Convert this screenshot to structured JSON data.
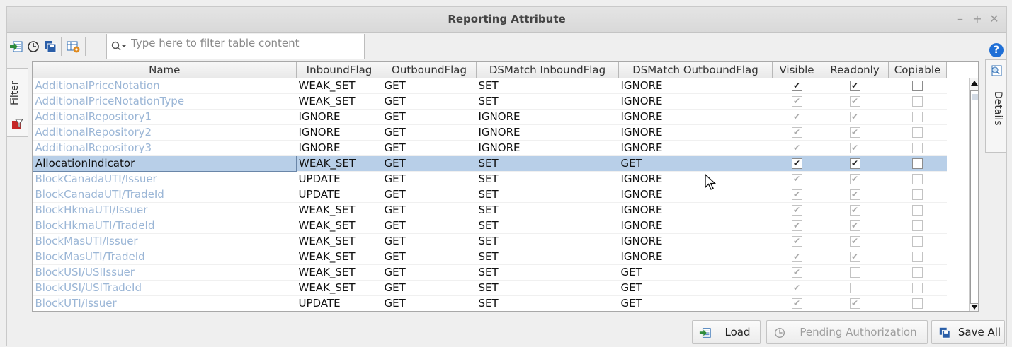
{
  "window": {
    "title": "Reporting Attribute",
    "minimize": "–",
    "maximize": "+",
    "close": "✕"
  },
  "toolbar": {
    "search_placeholder": "Type here to filter table content",
    "help": "?"
  },
  "side_tabs": {
    "filter": "Filter",
    "details": "Details"
  },
  "table": {
    "columns": [
      "Name",
      "InboundFlag",
      "OutboundFlag",
      "DSMatch InboundFlag",
      "DSMatch OutboundFlag",
      "Visible",
      "Readonly",
      "Copiable"
    ],
    "rows": [
      {
        "name": "AdditionalPriceNotation",
        "inbound": "WEAK_SET",
        "outbound": "GET",
        "ds_in": "SET",
        "ds_out": "IGNORE",
        "visible": true,
        "readonly": true,
        "copiable": false,
        "enabled": true
      },
      {
        "name": "AdditionalPriceNotationType",
        "inbound": "WEAK_SET",
        "outbound": "GET",
        "ds_in": "SET",
        "ds_out": "IGNORE",
        "visible": true,
        "readonly": true,
        "copiable": false,
        "enabled": false
      },
      {
        "name": "AdditionalRepository1",
        "inbound": "IGNORE",
        "outbound": "GET",
        "ds_in": "IGNORE",
        "ds_out": "IGNORE",
        "visible": true,
        "readonly": true,
        "copiable": false,
        "enabled": false
      },
      {
        "name": "AdditionalRepository2",
        "inbound": "IGNORE",
        "outbound": "GET",
        "ds_in": "IGNORE",
        "ds_out": "IGNORE",
        "visible": true,
        "readonly": true,
        "copiable": false,
        "enabled": false
      },
      {
        "name": "AdditionalRepository3",
        "inbound": "IGNORE",
        "outbound": "GET",
        "ds_in": "IGNORE",
        "ds_out": "IGNORE",
        "visible": true,
        "readonly": true,
        "copiable": false,
        "enabled": false
      },
      {
        "name": "AllocationIndicator",
        "inbound": "WEAK_SET",
        "outbound": "GET",
        "ds_in": "SET",
        "ds_out": "GET",
        "visible": true,
        "readonly": true,
        "copiable": false,
        "enabled": true,
        "selected": true
      },
      {
        "name": "BlockCanadaUTI/Issuer",
        "inbound": "UPDATE",
        "outbound": "GET",
        "ds_in": "SET",
        "ds_out": "IGNORE",
        "visible": true,
        "readonly": true,
        "copiable": false,
        "enabled": false
      },
      {
        "name": "BlockCanadaUTI/TradeId",
        "inbound": "UPDATE",
        "outbound": "GET",
        "ds_in": "SET",
        "ds_out": "IGNORE",
        "visible": true,
        "readonly": true,
        "copiable": false,
        "enabled": false
      },
      {
        "name": "BlockHkmaUTI/Issuer",
        "inbound": "WEAK_SET",
        "outbound": "GET",
        "ds_in": "SET",
        "ds_out": "IGNORE",
        "visible": true,
        "readonly": true,
        "copiable": false,
        "enabled": false
      },
      {
        "name": "BlockHkmaUTI/TradeId",
        "inbound": "WEAK_SET",
        "outbound": "GET",
        "ds_in": "SET",
        "ds_out": "IGNORE",
        "visible": true,
        "readonly": true,
        "copiable": false,
        "enabled": false
      },
      {
        "name": "BlockMasUTI/Issuer",
        "inbound": "WEAK_SET",
        "outbound": "GET",
        "ds_in": "SET",
        "ds_out": "IGNORE",
        "visible": true,
        "readonly": true,
        "copiable": false,
        "enabled": false
      },
      {
        "name": "BlockMasUTI/TradeId",
        "inbound": "WEAK_SET",
        "outbound": "GET",
        "ds_in": "SET",
        "ds_out": "IGNORE",
        "visible": true,
        "readonly": true,
        "copiable": false,
        "enabled": false
      },
      {
        "name": "BlockUSI/USIIssuer",
        "inbound": "WEAK_SET",
        "outbound": "GET",
        "ds_in": "SET",
        "ds_out": "GET",
        "visible": true,
        "readonly": false,
        "copiable": false,
        "enabled": false
      },
      {
        "name": "BlockUSI/USITradeId",
        "inbound": "WEAK_SET",
        "outbound": "GET",
        "ds_in": "SET",
        "ds_out": "GET",
        "visible": true,
        "readonly": false,
        "copiable": false,
        "enabled": false
      },
      {
        "name": "BlockUTI/Issuer",
        "inbound": "UPDATE",
        "outbound": "GET",
        "ds_in": "SET",
        "ds_out": "GET",
        "visible": true,
        "readonly": true,
        "copiable": false,
        "enabled": false
      }
    ]
  },
  "footer": {
    "load_label": "Load",
    "pending_label": "Pending Authorization",
    "save_all_label": "Save All"
  },
  "colors": {
    "selection": "#b8cfe8",
    "dim_text": "#9bb6d6",
    "help_blue": "#1f6fd6",
    "icon_green": "#2e8b3a"
  }
}
